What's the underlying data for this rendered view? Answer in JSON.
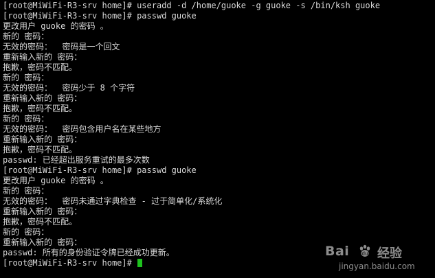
{
  "terminal": {
    "lines": [
      "[root@MiWiFi-R3-srv home]# useradd -d /home/guoke -g guoke -s /bin/ksh guoke",
      "[root@MiWiFi-R3-srv home]# passwd guoke",
      "更改用户 guoke 的密码 。",
      "新的 密码：",
      "无效的密码：  密码是一个回文",
      "重新输入新的 密码：",
      "抱歉，密码不匹配。",
      "新的 密码：",
      "无效的密码：  密码少于 8 个字符",
      "重新输入新的 密码：",
      "抱歉，密码不匹配。",
      "新的 密码：",
      "无效的密码：  密码包含用户名在某些地方",
      "重新输入新的 密码：",
      "抱歉，密码不匹配。",
      "passwd: 已经超出服务重试的最多次数",
      "[root@MiWiFi-R3-srv home]# passwd guoke",
      "更改用户 guoke 的密码 。",
      "新的 密码：",
      "无效的密码：  密码未通过字典检查 - 过于简单化/系统化",
      "重新输入新的 密码：",
      "抱歉，密码不匹配。",
      "新的 密码：",
      "重新输入新的 密码：",
      "passwd: 所有的身份验证令牌已经成功更新。"
    ],
    "prompt": "[root@MiWiFi-R3-srv home]# ",
    "cursor_color": "#1ec21e",
    "text_color": "#d9d9d9",
    "background_color": "#000000"
  },
  "watermark": {
    "brand_left": "Bai",
    "brand_right": "经验",
    "site": "jingyan.baidu.com",
    "icon": "baidu-paw-icon"
  }
}
